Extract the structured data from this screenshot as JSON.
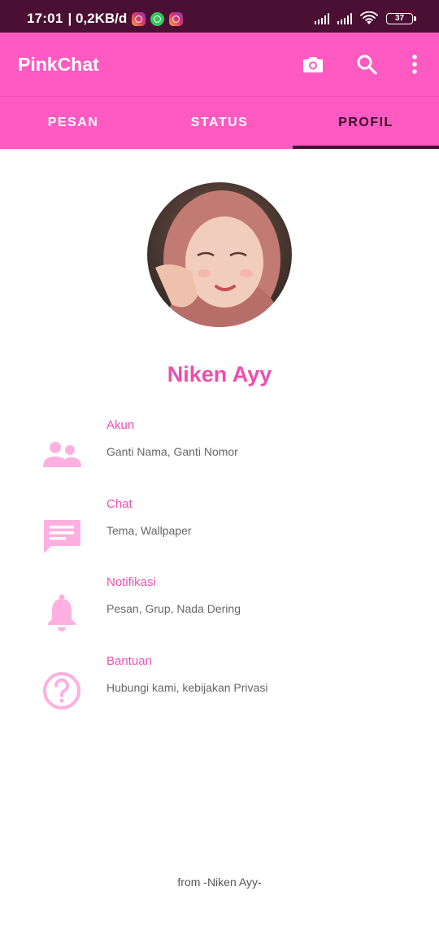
{
  "status_bar": {
    "time": "17:01",
    "network_speed": "| 0,2KB/d",
    "battery": "37",
    "notification_icons": [
      "instagram-icon",
      "whatsapp-icon",
      "instagram-icon"
    ]
  },
  "app_bar": {
    "title": "PinkChat",
    "actions": [
      "camera-icon",
      "search-icon",
      "more-vert-icon"
    ]
  },
  "tabs": [
    {
      "label": "PESAN",
      "active": false
    },
    {
      "label": "STATUS",
      "active": false
    },
    {
      "label": "PROFIL",
      "active": true
    }
  ],
  "profile": {
    "name": "Niken Ayy"
  },
  "settings": [
    {
      "icon": "people-icon",
      "title": "Akun",
      "subtitle": "Ganti Nama, Ganti Nomor"
    },
    {
      "icon": "chat-icon",
      "title": "Chat",
      "subtitle": "Tema, Wallpaper"
    },
    {
      "icon": "bell-icon",
      "title": "Notifikasi",
      "subtitle": "Pesan, Grup, Nada Dering"
    },
    {
      "icon": "help-icon",
      "title": "Bantuan",
      "subtitle": "Hubungi kami, kebijakan Privasi"
    }
  ],
  "footer": "from -Niken Ayy-",
  "colors": {
    "primary": "#ff5ac1",
    "status_bar": "#4a0f33",
    "accent_text": "#ee4dae",
    "icon_tint": "#ffb0e0"
  }
}
